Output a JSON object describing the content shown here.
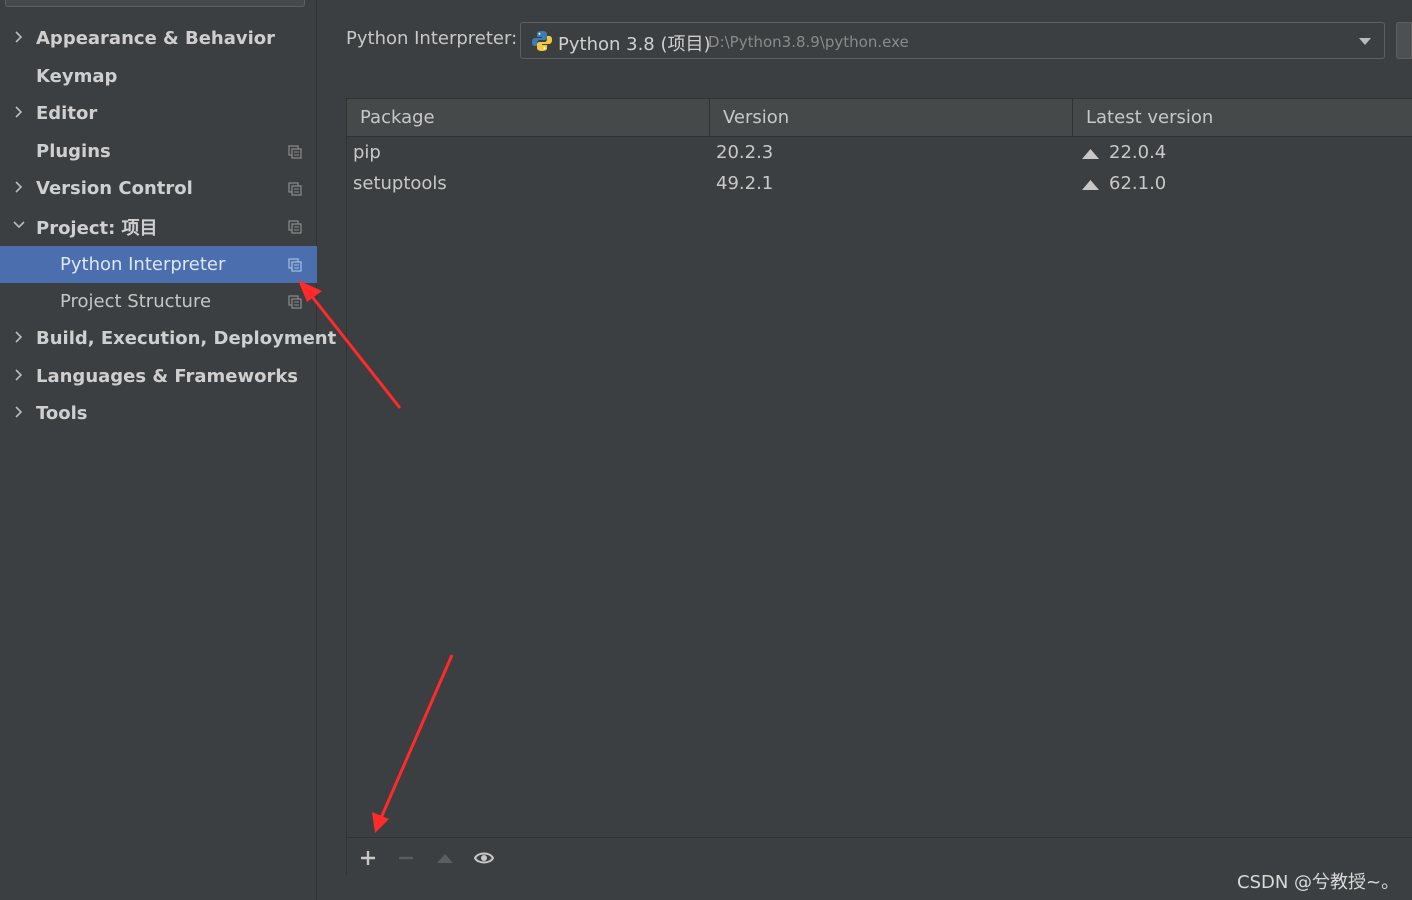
{
  "sidebar": {
    "items": [
      {
        "label": "Appearance & Behavior"
      },
      {
        "label": "Keymap"
      },
      {
        "label": "Editor"
      },
      {
        "label": "Plugins"
      },
      {
        "label": "Version Control"
      },
      {
        "label": "Project: 项目"
      },
      {
        "label": "Python Interpreter"
      },
      {
        "label": "Project Structure"
      },
      {
        "label": "Build, Execution, Deployment"
      },
      {
        "label": "Languages & Frameworks"
      },
      {
        "label": "Tools"
      }
    ],
    "selected": "Python Interpreter"
  },
  "interpreter": {
    "label": "Python Interpreter:",
    "name": "Python 3.8 (项目)",
    "path": "D:\\Python3.8.9\\python.exe"
  },
  "table": {
    "columns": [
      "Package",
      "Version",
      "Latest version"
    ],
    "rows": [
      {
        "package": "pip",
        "version": "20.2.3",
        "latest": "22.0.4"
      },
      {
        "package": "setuptools",
        "version": "49.2.1",
        "latest": "62.1.0"
      }
    ]
  },
  "toolbar": {
    "buttons": [
      "plus-icon",
      "minus-icon",
      "upgrade-icon",
      "eye-icon"
    ]
  },
  "watermark": "CSDN @兮教授~。",
  "colors": {
    "selection": "#4b6eaf",
    "background": "#3c3f41",
    "annotation": "#ff2a2a"
  }
}
